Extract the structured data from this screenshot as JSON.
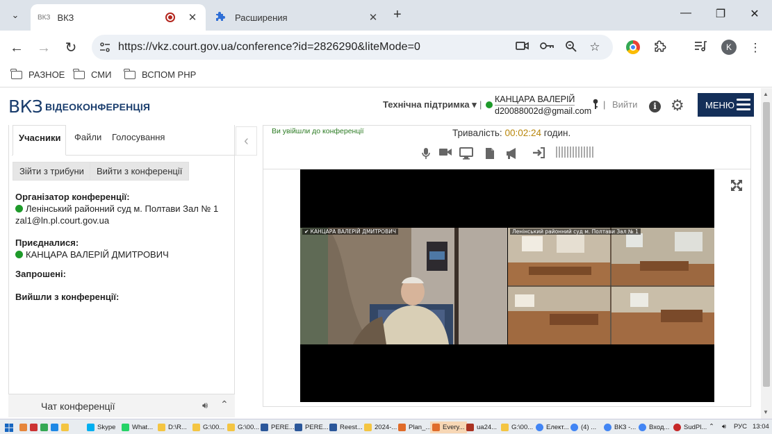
{
  "browser": {
    "tabs": [
      {
        "favicon": "ВКЗ",
        "title": "ВКЗ",
        "active": true
      },
      {
        "title": "Расширения",
        "active": false
      }
    ],
    "url": "https://vkz.court.gov.ua/conference?id=2826290&liteMode=0",
    "profile_initial": "K",
    "bookmarks": [
      "РАЗНОЕ",
      "СМИ",
      "ВСПОМ РНР"
    ]
  },
  "site": {
    "logo": "ВКЗ",
    "logo_sub": "ВІДЕОКОНФЕРЕНЦІЯ",
    "support": "Технічна підтримка ▾",
    "user_name": "КАНЦАРА ВАЛЕРІЙ",
    "user_email": "d20088002d@gmail.com",
    "logout": "Вийти",
    "menu": "МЕНЮ"
  },
  "left_panel": {
    "tabs": [
      "Учасники",
      "Файли",
      "Голосування"
    ],
    "buttons": [
      "Зійти з трибуни",
      "Вийти з конференції"
    ],
    "organizer_title": "Організатор конференції:",
    "organizer_name": "Ленінський районний суд м. Полтави Зал № 1",
    "organizer_email": "zal1@ln.pl.court.gov.ua",
    "joined_title": "Приєдналися:",
    "joined_name": "КАНЦАРА ВАЛЕРІЙ ДМИТРОВИЧ",
    "invited_title": "Запрошені:",
    "left_title": "Вийшли з конференції:",
    "chat_label": "Чат конференції"
  },
  "conference": {
    "joined_message": "Ви увійшли до конференції",
    "duration_label": "Тривалість:",
    "duration_value": "00:02:24",
    "duration_unit": "годин.",
    "feed_left_label": "✔ КАНЦАРА ВАЛЕРІЙ ДМИТРОВИЧ",
    "feed_right_label": "Ленінський районний суд м. Полтави Зал № 1"
  },
  "taskbar": {
    "items": [
      "Skype",
      "What...",
      "D:\\R...",
      "G:\\00...",
      "G:\\00...",
      "PERE...",
      "PERE...",
      "Reest...",
      "2024-...",
      "Plan_...",
      "Every...",
      "ua24...",
      "G:\\00...",
      "Елект...",
      "(4) ...",
      "ВКЗ -...",
      "Вход...",
      "SudPl..."
    ],
    "lang": "РУС",
    "time": "13:04"
  },
  "colors": {
    "navy": "#142f59",
    "online": "#1e9a2a",
    "duration": "#b8860b"
  }
}
